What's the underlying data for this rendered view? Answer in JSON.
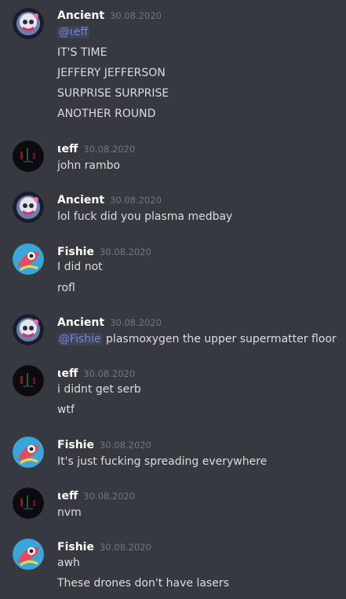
{
  "messages": [
    {
      "author": "Ancient",
      "timestamp": "30.08.2020",
      "avatar_icon": "ancient-avatar-icon",
      "lines": [
        {
          "mention": "@ιeff",
          "text": ""
        },
        {
          "text": "IT'S TIME"
        },
        {
          "text": "JEFFERY JEFFERSON"
        },
        {
          "text": "SURPRISE SURPRISE"
        },
        {
          "text": "ANOTHER ROUND"
        }
      ]
    },
    {
      "author": "ιeff",
      "timestamp": "30.08.2020",
      "avatar_icon": "ieff-avatar-icon",
      "lines": [
        {
          "text": "john rambo"
        }
      ]
    },
    {
      "author": "Ancient",
      "timestamp": "30.08.2020",
      "avatar_icon": "ancient-avatar-icon",
      "lines": [
        {
          "text": "lol fuck did you plasma medbay"
        }
      ]
    },
    {
      "author": "Fishie",
      "timestamp": "30.08.2020",
      "avatar_icon": "fishie-avatar-icon",
      "lines": [
        {
          "text": "I did not"
        },
        {
          "text": "rofl"
        }
      ]
    },
    {
      "author": "Ancient",
      "timestamp": "30.08.2020",
      "avatar_icon": "ancient-avatar-icon",
      "lines": [
        {
          "mention": "@Fishie",
          "text": " plasmoxygen the upper supermatter floor"
        }
      ]
    },
    {
      "author": "ιeff",
      "timestamp": "30.08.2020",
      "avatar_icon": "ieff-avatar-icon",
      "lines": [
        {
          "text": "i didnt get serb"
        },
        {
          "text": "wtf"
        }
      ]
    },
    {
      "author": "Fishie",
      "timestamp": "30.08.2020",
      "avatar_icon": "fishie-avatar-icon",
      "lines": [
        {
          "text": "It's just fucking spreading everywhere"
        }
      ]
    },
    {
      "author": "ιeff",
      "timestamp": "30.08.2020",
      "avatar_icon": "ieff-avatar-icon",
      "lines": [
        {
          "text": "nvm"
        }
      ]
    },
    {
      "author": "Fishie",
      "timestamp": "30.08.2020",
      "avatar_icon": "fishie-avatar-icon",
      "lines": [
        {
          "text": "awh"
        },
        {
          "text": "These drones don't have lasers"
        }
      ]
    }
  ],
  "colors": {
    "background": "#36393f",
    "username": "#ffffff",
    "timestamp": "#72767d",
    "message_text": "#dcddde",
    "mention_text": "#7289da"
  }
}
